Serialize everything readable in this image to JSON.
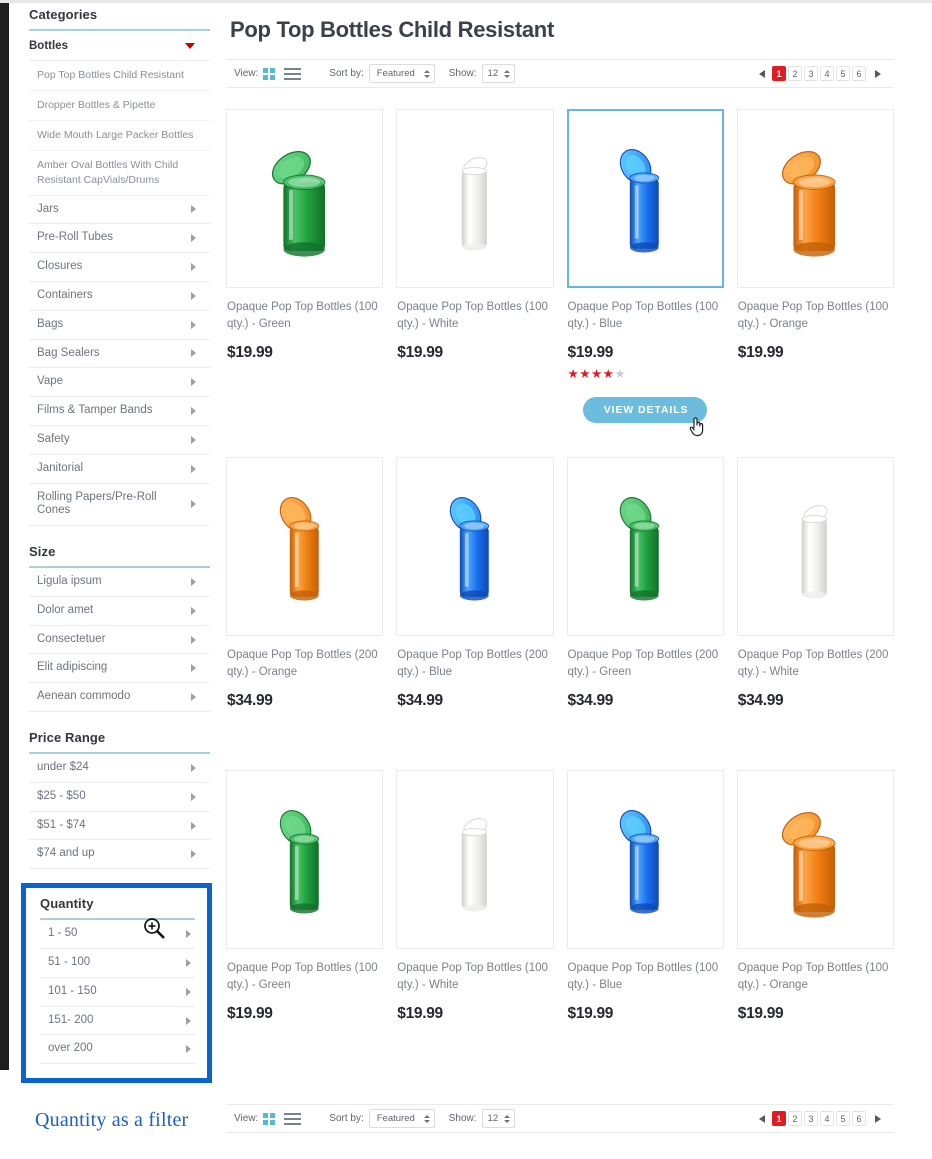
{
  "sidebar": {
    "categories": {
      "title": "Categories",
      "lead": {
        "label": "Bottles",
        "icon": "caret-down-icon"
      },
      "subcategories": [
        "Pop Top Bottles Child Resistant",
        "Dropper Bottles & Pipette",
        "Wide Mouth Large Packer Bottles",
        "Amber Oval Bottles With Child Resistant CapVials/Drums"
      ],
      "items": [
        "Jars",
        "Pre-Roll Tubes",
        "Closures",
        "Containers",
        "Bags",
        "Bag Sealers",
        "Vape",
        "Films & Tamper Bands",
        "Safety",
        "Janitorial",
        "Rolling Papers/Pre-Roll Cones"
      ]
    },
    "size": {
      "title": "Size",
      "items": [
        "Ligula ipsum",
        "Dolor amet",
        "Consectetuer",
        "Elit adipiscing",
        "Aenean commodo"
      ]
    },
    "price_range": {
      "title": "Price Range",
      "items": [
        "under $24",
        "$25 - $50",
        "$51 - $74",
        "$74 and up"
      ]
    },
    "quantity": {
      "title": "Quantity",
      "items": [
        "1 - 50",
        "51 - 100",
        "101 - 150",
        "151- 200",
        "over 200"
      ],
      "highlight_color": "#0b63ce"
    },
    "annotation": "Quantity as a filter"
  },
  "main": {
    "title": "Pop Top Bottles Child Resistant",
    "toolbar": {
      "view_label": "View:",
      "sort_label": "Sort by:",
      "sort_value": "Featured",
      "show_label": "Show:",
      "show_value": "12",
      "pages": [
        "1",
        "2",
        "3",
        "4",
        "5",
        "6"
      ],
      "active_page": "1"
    },
    "view_details_label": "VIEW DETAILS",
    "products": [
      {
        "name": "Opaque Pop Top Bottles (100 qty.) - Green",
        "price": "$19.99",
        "color": "green",
        "shape": "open-wide",
        "selected": false,
        "rating": 0
      },
      {
        "name": "Opaque Pop Top Bottles (100 qty.) - White",
        "price": "$19.99",
        "color": "white",
        "shape": "closed-tall",
        "selected": false,
        "rating": 0
      },
      {
        "name": "Opaque Pop Top Bottles (100 qty.) - Blue",
        "price": "$19.99",
        "color": "blue",
        "shape": "open-tall",
        "selected": true,
        "rating": 4
      },
      {
        "name": "Opaque Pop Top Bottles (100 qty.) - Orange",
        "price": "$19.99",
        "color": "orange",
        "shape": "open-wide",
        "selected": false,
        "rating": 0
      },
      {
        "name": "Opaque Pop Top Bottles (200 qty.) - Orange",
        "price": "$34.99",
        "color": "orange",
        "shape": "open-tall",
        "selected": false,
        "rating": 0
      },
      {
        "name": "Opaque Pop Top Bottles (200 qty.) - Blue",
        "price": "$34.99",
        "color": "blue",
        "shape": "open-tall",
        "selected": false,
        "rating": 0
      },
      {
        "name": "Opaque Pop Top Bottles (200 qty.) - Green",
        "price": "$34.99",
        "color": "green",
        "shape": "open-tall",
        "selected": false,
        "rating": 0
      },
      {
        "name": "Opaque Pop Top Bottles (200 qty.) - White",
        "price": "$34.99",
        "color": "white",
        "shape": "closed-tall",
        "selected": false,
        "rating": 0
      },
      {
        "name": "Opaque Pop Top Bottles (100 qty.) - Green",
        "price": "$19.99",
        "color": "green",
        "shape": "open-tall",
        "selected": false,
        "rating": 0
      },
      {
        "name": "Opaque Pop Top Bottles (100 qty.) - White",
        "price": "$19.99",
        "color": "white",
        "shape": "closed-tall",
        "selected": false,
        "rating": 0
      },
      {
        "name": "Opaque Pop Top Bottles (100 qty.) - Blue",
        "price": "$19.99",
        "color": "blue",
        "shape": "open-tall",
        "selected": false,
        "rating": 0
      },
      {
        "name": "Opaque Pop Top Bottles (100 qty.) - Orange",
        "price": "$19.99",
        "color": "orange",
        "shape": "open-wide",
        "selected": false,
        "rating": 0
      }
    ]
  },
  "colors": {
    "accent_blue": "#62b9dd",
    "pager_active": "#e21b22",
    "star": "#e21b22",
    "highlight": "#0b63ce",
    "annotation": "#1a5fc8"
  }
}
